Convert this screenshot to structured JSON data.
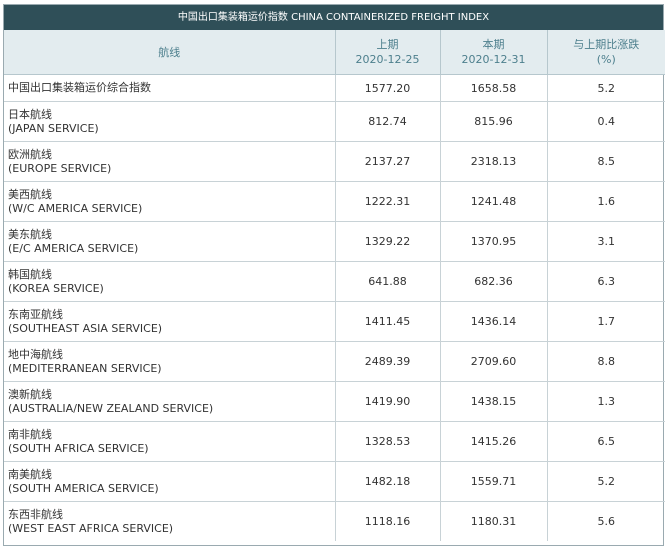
{
  "banner": {
    "title": "中国出口集装箱运价指数 CHINA CONTAINERIZED FREIGHT INDEX"
  },
  "header": {
    "route": "航线",
    "prev_label": "上期",
    "prev_date": "2020-12-25",
    "curr_label": "本期",
    "curr_date": "2020-12-31",
    "change_label": "与上期比涨跌",
    "change_unit": "(%)"
  },
  "rows": [
    {
      "cn": "中国出口集装箱运价综合指数",
      "en": "",
      "prev": "1577.20",
      "curr": "1658.58",
      "change": "5.2"
    },
    {
      "cn": "日本航线",
      "en": "(JAPAN SERVICE)",
      "prev": "812.74",
      "curr": "815.96",
      "change": "0.4"
    },
    {
      "cn": "欧洲航线",
      "en": "(EUROPE SERVICE)",
      "prev": "2137.27",
      "curr": "2318.13",
      "change": "8.5"
    },
    {
      "cn": "美西航线",
      "en": "(W/C AMERICA SERVICE)",
      "prev": "1222.31",
      "curr": "1241.48",
      "change": "1.6"
    },
    {
      "cn": "美东航线",
      "en": "(E/C AMERICA SERVICE)",
      "prev": "1329.22",
      "curr": "1370.95",
      "change": "3.1"
    },
    {
      "cn": "韩国航线",
      "en": "(KOREA SERVICE)",
      "prev": "641.88",
      "curr": "682.36",
      "change": "6.3"
    },
    {
      "cn": "东南亚航线",
      "en": "(SOUTHEAST ASIA SERVICE)",
      "prev": "1411.45",
      "curr": "1436.14",
      "change": "1.7"
    },
    {
      "cn": "地中海航线",
      "en": "(MEDITERRANEAN SERVICE)",
      "prev": "2489.39",
      "curr": "2709.60",
      "change": "8.8"
    },
    {
      "cn": "澳新航线",
      "en": "(AUSTRALIA/NEW ZEALAND SERVICE)",
      "prev": "1419.90",
      "curr": "1438.15",
      "change": "1.3"
    },
    {
      "cn": "南非航线",
      "en": "(SOUTH AFRICA SERVICE)",
      "prev": "1328.53",
      "curr": "1415.26",
      "change": "6.5"
    },
    {
      "cn": "南美航线",
      "en": "(SOUTH AMERICA SERVICE)",
      "prev": "1482.18",
      "curr": "1559.71",
      "change": "5.2"
    },
    {
      "cn": "东西非航线",
      "en": "(WEST EAST AFRICA SERVICE)",
      "prev": "1118.16",
      "curr": "1180.31",
      "change": "5.6"
    }
  ],
  "colors": {
    "banner_bg": "#2f4f58",
    "header_bg": "#e3ecef",
    "header_text": "#4d7f8d",
    "grid_line": "#c8d2d6"
  }
}
